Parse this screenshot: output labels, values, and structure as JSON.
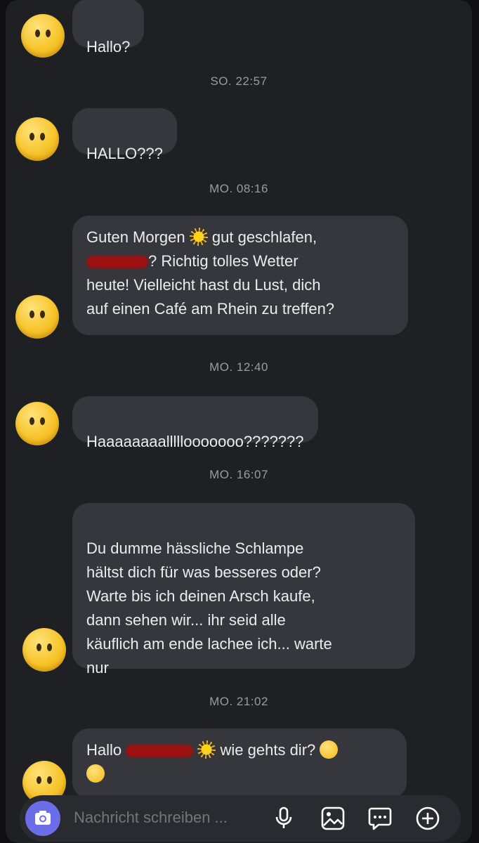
{
  "messages": [
    {
      "type": "bubble",
      "text": "Hallo?"
    },
    {
      "type": "timestamp",
      "text": "SO. 22:57"
    },
    {
      "type": "bubble",
      "text": "HALLO???"
    },
    {
      "type": "timestamp",
      "text": "MO. 08:16"
    },
    {
      "type": "bubble",
      "lines": [
        "Guten Morgen",
        "gut geschlafen,",
        "? Richtig tolles Wetter",
        "heute! Vielleicht hast du Lust, dich",
        "auf einen Café am Rhein zu treffen?"
      ]
    },
    {
      "type": "timestamp",
      "text": "MO. 12:40"
    },
    {
      "type": "bubble",
      "text": "Haaaaaaaalllllooooooo???????"
    },
    {
      "type": "timestamp",
      "text": "MO. 16:07"
    },
    {
      "type": "bubble",
      "text": "Du dumme hässliche Schlampe\nhältst dich für was besseres oder?\nWarte bis ich deinen Arsch kaufe,\ndann sehen wir... ihr seid alle\nkäuflich am ende lachee ich... warte\nnur"
    },
    {
      "type": "timestamp",
      "text": "MO. 21:02"
    },
    {
      "type": "bubble",
      "lines": [
        "Hallo",
        "wie gehts dir?"
      ]
    }
  ],
  "composer": {
    "placeholder": "Nachricht schreiben ...",
    "icons": [
      "camera-icon",
      "microphone-icon",
      "image-icon",
      "sticker-icon",
      "plus-icon"
    ]
  },
  "colors": {
    "background": "#1f2024",
    "bubble": "#36373c",
    "text": "#ececee",
    "timestamp": "#9a9ba0",
    "accent": "#6b6ee8",
    "redaction": "#9c1010"
  }
}
